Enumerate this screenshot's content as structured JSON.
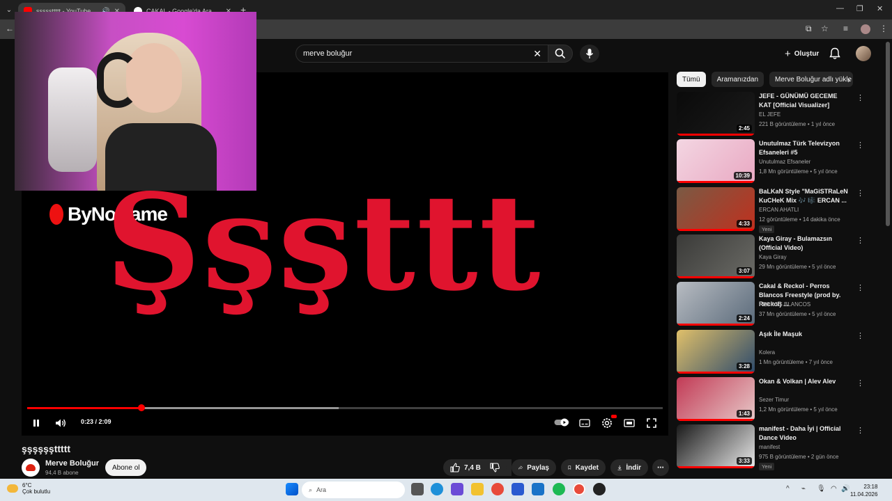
{
  "browser": {
    "tabs": [
      {
        "title": "şşşşşttttt - YouTube",
        "active": true
      },
      {
        "title": "ÇAKAL - Google'da Ara",
        "active": false
      }
    ]
  },
  "header": {
    "search_query": "merve boluğur",
    "create_label": "Oluştur"
  },
  "player": {
    "overlay_logo_text": "ByNoGame",
    "overlay_big_text": "Şşşttt",
    "time_display": "0:23 / 2:09",
    "progress_played_fraction": 0.18,
    "progress_buffered_fraction": 0.49
  },
  "video": {
    "title": "şşşşşşttttt",
    "channel_name": "Merve Boluğur",
    "subscribers": "94,4 B abone",
    "subscribe_label": "Abone ol",
    "likes": "7,4 B",
    "share_label": "Paylaş",
    "save_label": "Kaydet",
    "download_label": "İndir"
  },
  "sidebar": {
    "chips": [
      "Tümü",
      "Aramanızdan",
      "Merve Boluğur adlı yükle"
    ],
    "recommendations": [
      {
        "title": "JEFE - GÜNÜMÜ GECEME KAT [Official Visualizer]",
        "channel": "EL JEFE",
        "meta": "221 B görüntüleme • 1 yıl önce",
        "duration": "2:45",
        "badge": "",
        "colors": [
          "#0a0a0a",
          "#1b1b1b"
        ]
      },
      {
        "title": "Unutulmaz Türk Televizyon Efsaneleri #5",
        "channel": "Unutulmaz Efsaneler",
        "meta": "1,8 Mn görüntüleme • 5 yıl önce",
        "duration": "10:39",
        "badge": "",
        "colors": [
          "#f3d6e2",
          "#e9a8c2"
        ]
      },
      {
        "title": "BaLKaN Style \"MaGiSTRaLeN KuCHeK Mix 🎶 🎼 ERCAN ...",
        "channel": "ERCAN AHATLI",
        "meta": "12 görüntüleme • 14 dakika önce",
        "duration": "4:33",
        "badge": "Yeni",
        "colors": [
          "#7a5a44",
          "#c0301e"
        ]
      },
      {
        "title": "Kaya Giray - Bulamazsın (Official Video)",
        "channel": "Kaya Giray",
        "meta": "29 Mn görüntüleme • 5 yıl önce",
        "duration": "3:07",
        "badge": "",
        "colors": [
          "#3a3a38",
          "#6b6b66"
        ]
      },
      {
        "title": "Cakal & Reckol - Perros Blancos Freestyle (prod by. Reckol) ...",
        "channel": "PERROS BLANCOS",
        "meta": "37 Mn görüntüleme • 5 yıl önce",
        "duration": "2:24",
        "badge": "",
        "colors": [
          "#b8bcc2",
          "#5a6a7a"
        ]
      },
      {
        "title": "Aşık İle Maşuk",
        "channel": "Kolera",
        "meta": "1 Mn görüntüleme • 7 yıl önce",
        "duration": "3:28",
        "badge": "",
        "colors": [
          "#e0c06a",
          "#2d4a6b"
        ]
      },
      {
        "title": "Okan & Volkan | Alev Alev",
        "channel": "Sezer Timur",
        "meta": "1,2 Mn görüntüleme • 5 yıl önce",
        "duration": "1:43",
        "badge": "",
        "colors": [
          "#c23a55",
          "#e7c8c8"
        ]
      },
      {
        "title": "manifest - Daha İyi | Official Dance Video",
        "channel": "manifest",
        "meta": "975 B görüntüleme • 2 gün önce",
        "duration": "3:33",
        "badge": "Yeni",
        "colors": [
          "#1a1a1a",
          "#e9e9e9"
        ]
      }
    ]
  },
  "taskbar": {
    "temperature": "6°C",
    "condition": "Çok bulutlu",
    "search_placeholder": "Ara",
    "time": "23:18",
    "date": "11.04.2026"
  },
  "colors": {
    "accent_red": "#ff0000",
    "overlay_text_red": "#e0142e",
    "background": "#0f0f0f"
  }
}
